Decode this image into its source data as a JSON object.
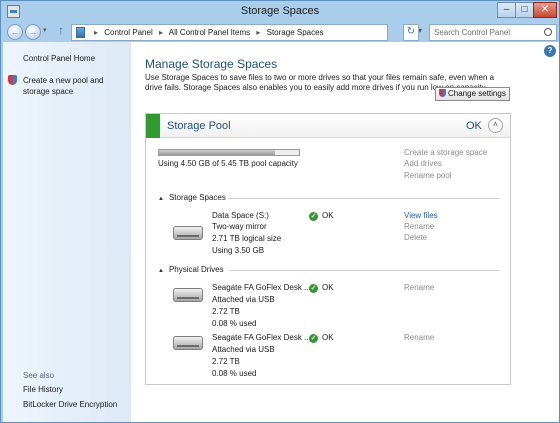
{
  "window": {
    "title": "Storage Spaces"
  },
  "nav": {
    "back_glyph": "←",
    "forward_glyph": "→",
    "up_glyph": "↑",
    "dropdown_glyph": "▾",
    "refresh_glyph": "↻",
    "breadcrumbs": [
      "Control Panel",
      "All Control Panel Items",
      "Storage Spaces"
    ],
    "breadcrumb_sep": "▸",
    "search_placeholder": "Search Control Panel"
  },
  "sysbuttons": {
    "minimize": "–",
    "maximize": "□",
    "close": "✕"
  },
  "sidebar": {
    "home": "Control Panel Home",
    "create": "Create a new pool and storage space",
    "see_also": "See also",
    "links": [
      "File History",
      "BitLocker Drive Encryption"
    ]
  },
  "help_glyph": "?",
  "main": {
    "title": "Manage Storage Spaces",
    "description": "Use Storage Spaces to save files to two or more drives so that your files remain safe, even when a drive fails. Storage Spaces also enables you to easily add more drives if you run low on capacity.",
    "change_settings": "Change settings"
  },
  "pool": {
    "name": "Storage Pool",
    "status": "OK",
    "collapse_glyph": "˄",
    "usage_fraction": 0.825,
    "usage_text": "Using 4.50 GB of 5.45 TB pool capacity",
    "actions": [
      "Create a storage space",
      "Add drives",
      "Rename pool"
    ],
    "spaces_header": "Storage Spaces",
    "drives_header": "Physical Drives",
    "collapse_tri": "▲",
    "spaces": [
      {
        "lines": [
          "Data Space (S:)",
          "Two-way mirror",
          "2.71 TB logical size",
          "Using 3.50 GB"
        ],
        "status": "OK",
        "actions": [
          "View files",
          "Rename",
          "Delete"
        ]
      }
    ],
    "drives": [
      {
        "lines": [
          "Seagate FA GoFlex Desk ...",
          "Attached via USB",
          "2.72 TB",
          "0.08 % used"
        ],
        "status": "OK",
        "action": "Rename"
      },
      {
        "lines": [
          "Seagate FA GoFlex Desk ...",
          "Attached via USB",
          "2.72 TB",
          "0.08 % used"
        ],
        "status": "OK",
        "action": "Rename"
      }
    ]
  },
  "icons": {
    "check": "✓",
    "app": "storage-spaces-icon",
    "shield": "shield-icon",
    "disk": "hard-drive-icon",
    "search": "search-icon"
  },
  "colors": {
    "pool_accent": "#2f9a2f",
    "link": "#1f5fa8",
    "title": "#1f4e86"
  }
}
